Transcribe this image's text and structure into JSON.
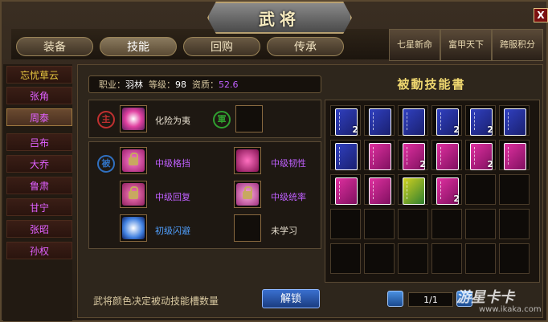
{
  "window": {
    "title": "武将",
    "close_label": "X"
  },
  "tabs": [
    {
      "label": "装备",
      "active": false
    },
    {
      "label": "技能",
      "active": true
    },
    {
      "label": "回购",
      "active": false
    },
    {
      "label": "传承",
      "active": false
    }
  ],
  "banners": [
    "七星新命",
    "富甲天下",
    "跨服积分"
  ],
  "heroes": [
    {
      "name": "忘忧草云",
      "color": "yellow",
      "active": false
    },
    {
      "name": "张角",
      "color": "purple",
      "active": false
    },
    {
      "name": "周泰",
      "color": "purple",
      "active": true
    },
    {
      "name": "吕布",
      "color": "purple",
      "active": false
    },
    {
      "name": "大乔",
      "color": "purple",
      "active": false
    },
    {
      "name": "鲁肃",
      "color": "purple",
      "active": false
    },
    {
      "name": "甘宁",
      "color": "purple",
      "active": false
    },
    {
      "name": "张昭",
      "color": "purple",
      "active": false
    },
    {
      "name": "孙权",
      "color": "purple",
      "active": false
    }
  ],
  "info": {
    "job_label": "职业：",
    "job": "羽林",
    "level_label": "等级：",
    "level": "98",
    "aptitude_label": "资质：",
    "aptitude": "52.6"
  },
  "main_skill": {
    "badge": "主",
    "name": "化险为夷",
    "army_badge": "軍"
  },
  "passive": {
    "badge": "被",
    "skills": [
      {
        "name": "中级格挡",
        "color": "purple"
      },
      {
        "name": "中级韧性",
        "color": "purple"
      },
      {
        "name": "中级回复",
        "color": "purple"
      },
      {
        "name": "中级统率",
        "color": "purple"
      },
      {
        "name": "初级闪避",
        "color": "blue"
      },
      {
        "name": "未学习",
        "color": "white"
      }
    ]
  },
  "book_panel": {
    "title": "被動技能書"
  },
  "books": [
    {
      "color": "blue",
      "count": "2"
    },
    {
      "color": "blue",
      "count": ""
    },
    {
      "color": "blue",
      "count": ""
    },
    {
      "color": "blue",
      "count": "2"
    },
    {
      "color": "blue",
      "count": "2"
    },
    {
      "color": "blue",
      "count": ""
    },
    {
      "color": "blue",
      "count": ""
    },
    {
      "color": "pink",
      "count": ""
    },
    {
      "color": "pink",
      "count": "2"
    },
    {
      "color": "pink",
      "count": ""
    },
    {
      "color": "pink",
      "count": "2"
    },
    {
      "color": "pink",
      "count": ""
    },
    {
      "color": "pink",
      "count": ""
    },
    {
      "color": "pink",
      "count": ""
    },
    {
      "color": "yellow",
      "count": ""
    },
    {
      "color": "pink",
      "count": "2"
    }
  ],
  "footer": {
    "note": "武将颜色决定被动技能槽数量",
    "unlock_label": "解锁",
    "page": "1/1"
  },
  "watermark": {
    "brand": "游星卡卡",
    "url": "www.ikaka.com"
  }
}
